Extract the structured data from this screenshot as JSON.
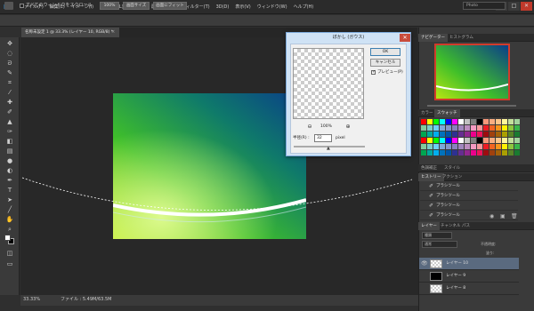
{
  "app": {
    "logo": "Ps",
    "menus": [
      "ファイル(F)",
      "編集(E)",
      "イメージ(I)",
      "レイヤー(L)",
      "書式(Y)",
      "選択範囲(S)",
      "フィルター(T)",
      "3D(D)",
      "表示(V)",
      "ウィンドウ(W)",
      "ヘルプ(H)"
    ],
    "window_controls": {
      "minimize": "–",
      "maximize": "□",
      "close": "✕"
    }
  },
  "options_bar": {
    "scroll_all": "すべてのウィンドウをスクロール",
    "btn_100": "100%",
    "btn_fit": "画面サイズ",
    "btn_fill": "画面にフィット",
    "workspace": "Photo"
  },
  "document": {
    "tab_title": "名称未設定 1 @ 33.3% (レイヤー 10, RGB/8) *",
    "zoom": "33.33%",
    "file_info": "ファイル : 5.49M/63.5M"
  },
  "dialog": {
    "title": "ぼかし (ガウス)",
    "close": "✕",
    "ok": "OK",
    "cancel": "キャンセル",
    "preview_label": "プレビュー(P)",
    "preview_checked": "✓",
    "zoom_out": "⊖",
    "zoom_in": "⊕",
    "zoom_percent": "100%",
    "radius_label": "半径(R) :",
    "radius_value": "32",
    "radius_unit": "pixel"
  },
  "panels": {
    "navigator": {
      "tabs": [
        "ナビゲーター",
        "ヒストグラム"
      ]
    },
    "color": {
      "tabs": [
        "カラー",
        "スウォッチ"
      ]
    },
    "styles": {
      "tabs": [
        "色調補正",
        "スタイル"
      ]
    },
    "history": {
      "tabs": [
        "ヒストリー",
        "アクション"
      ],
      "items": [
        "ブラシツール",
        "ブラシツール",
        "ブラシツール",
        "ブラシツール"
      ]
    },
    "layers": {
      "tabs": [
        "レイヤー",
        "チャンネル",
        "パス"
      ],
      "filter_kind": "種類",
      "blend_mode": "通常",
      "opacity_label": "不透明度:",
      "fill_label": "塗り:",
      "items": [
        {
          "name": "レイヤー 10",
          "eye": "👁"
        },
        {
          "name": "レイヤー 9",
          "eye": ""
        },
        {
          "name": "レイヤー 8",
          "eye": ""
        }
      ]
    }
  },
  "colors": {
    "accent": "#31a8ff",
    "dialog_bg": "#cfe2f5",
    "selected_layer": "#5a6a7f"
  }
}
